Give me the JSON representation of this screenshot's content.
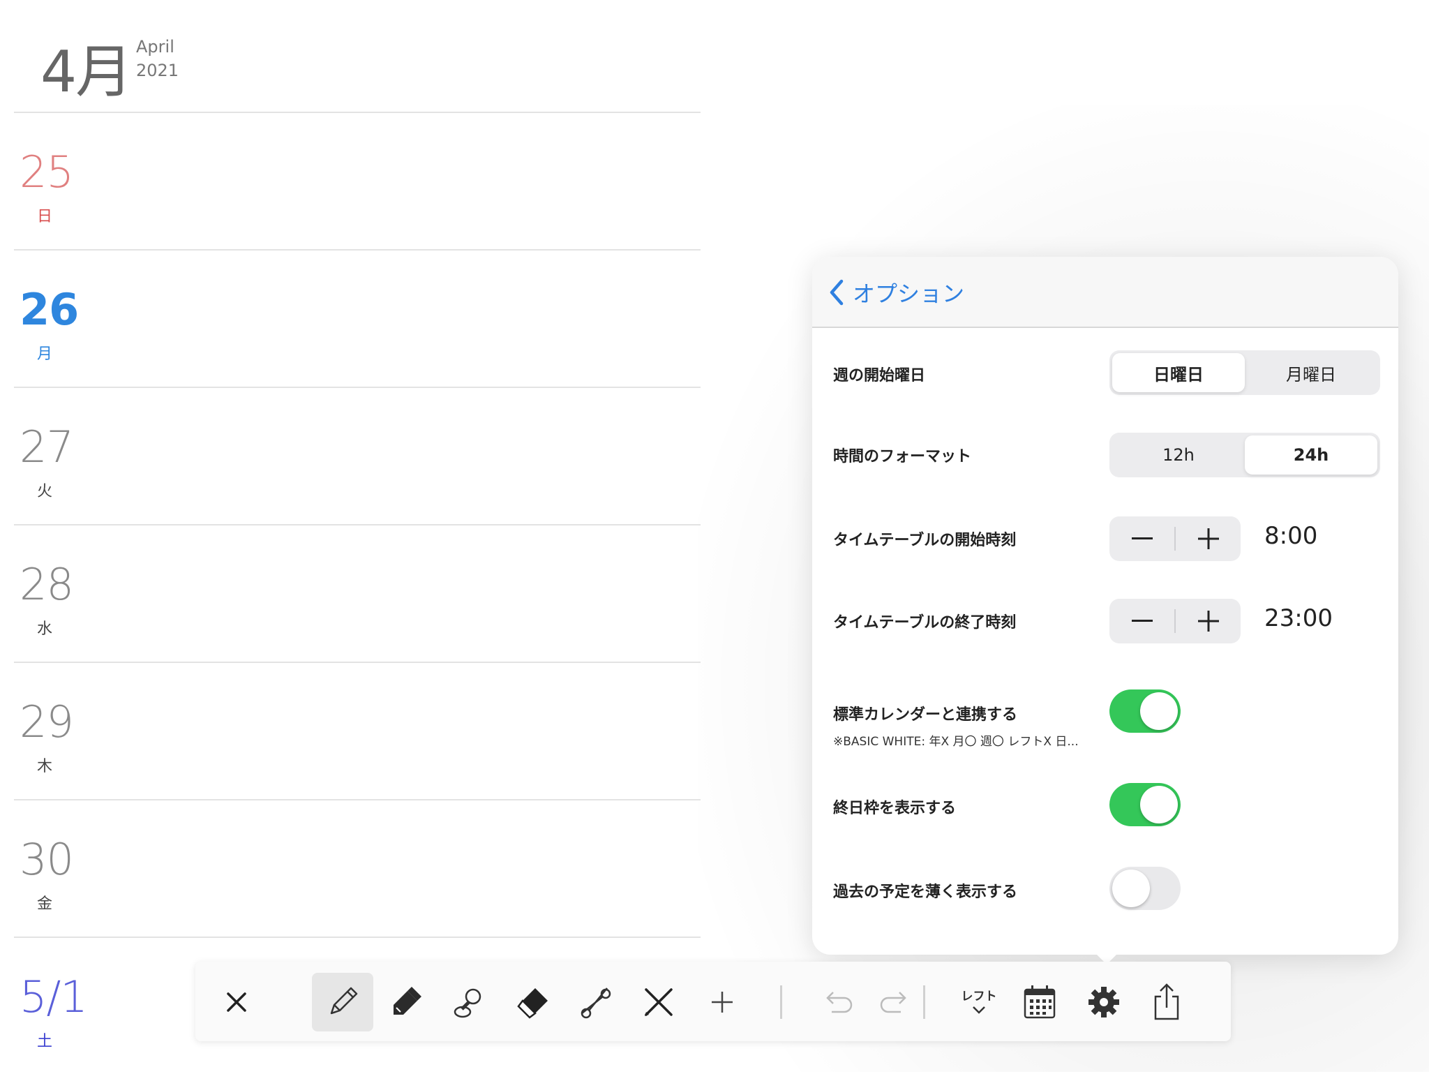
{
  "header": {
    "month_jp": "4月",
    "month_en": "April",
    "year": "2021"
  },
  "days": [
    {
      "num": "25",
      "weekday": "日",
      "style": "sun"
    },
    {
      "num": "26",
      "weekday": "月",
      "style": "today"
    },
    {
      "num": "27",
      "weekday": "火",
      "style": "norm"
    },
    {
      "num": "28",
      "weekday": "水",
      "style": "norm"
    },
    {
      "num": "29",
      "weekday": "木",
      "style": "norm"
    },
    {
      "num": "30",
      "weekday": "金",
      "style": "norm"
    },
    {
      "num": "5/1",
      "weekday": "土",
      "style": "sat"
    }
  ],
  "popover": {
    "back_label": "オプション",
    "week_start": {
      "label": "週の開始曜日",
      "options": [
        "日曜日",
        "月曜日"
      ],
      "selected": 0
    },
    "time_format": {
      "label": "時間のフォーマット",
      "options": [
        "12h",
        "24h"
      ],
      "selected": 1
    },
    "tt_start": {
      "label": "タイムテーブルの開始時刻",
      "value": "8:00"
    },
    "tt_end": {
      "label": "タイムテーブルの終了時刻",
      "value": "23:00"
    },
    "sync_calendar": {
      "label": "標準カレンダーと連携する",
      "sub": "※BASIC WHITE: 年X 月〇 週〇 レフトX 日...",
      "on": true
    },
    "all_day": {
      "label": "終日枠を表示する",
      "on": true
    },
    "fade_past": {
      "label": "過去の予定を薄く表示する",
      "on": false
    }
  },
  "toolbar": {
    "layout_label": "レフト"
  },
  "colors": {
    "accent_blue": "#2f80e0",
    "toggle_on": "#34c759",
    "sunday_red": "#d84c4c",
    "saturday_blue": "#3a3fd0"
  }
}
